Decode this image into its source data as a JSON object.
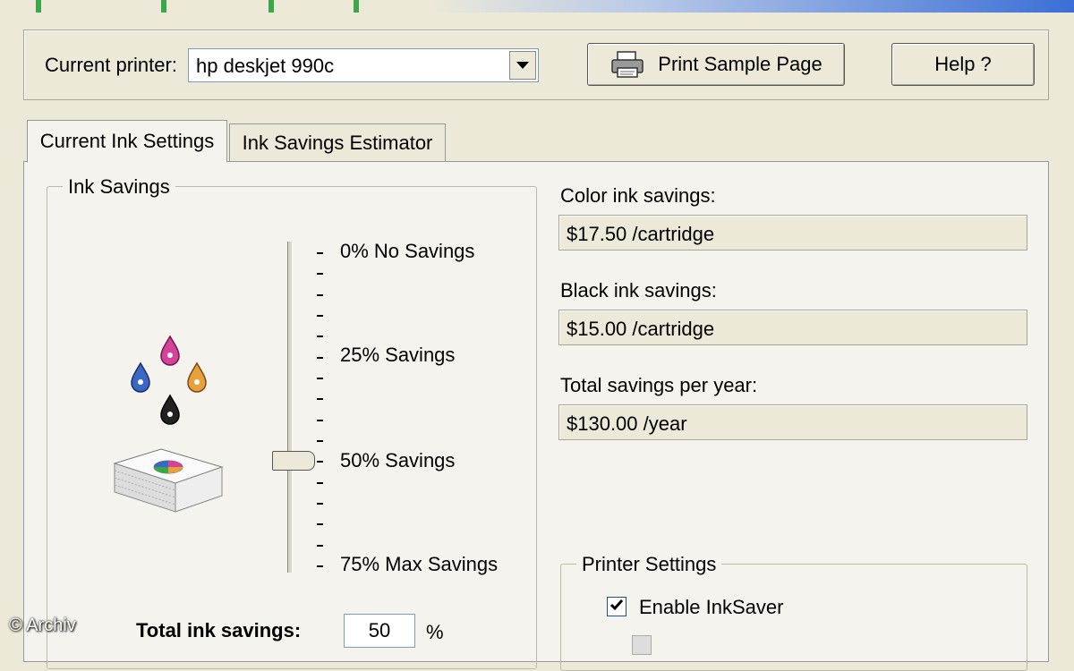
{
  "toolbar": {
    "current_printer_label": "Current printer:",
    "printer_value": "hp deskjet 990c",
    "print_sample_label": "Print Sample Page",
    "help_label": "Help ?"
  },
  "tabs": [
    {
      "label": "Current Ink Settings",
      "active": true
    },
    {
      "label": "Ink Savings Estimator",
      "active": false
    }
  ],
  "ink_savings": {
    "group_title": "Ink Savings",
    "scale": [
      {
        "percent": 0,
        "label": "0% No Savings"
      },
      {
        "percent": 25,
        "label": "25% Savings"
      },
      {
        "percent": 50,
        "label": "50% Savings"
      },
      {
        "percent": 75,
        "label": "75% Max Savings"
      }
    ],
    "slider_value_percent": 50,
    "total_label": "Total ink savings:",
    "total_value": "50",
    "total_unit": "%"
  },
  "estimates": {
    "color_label": "Color ink savings:",
    "color_value": "$17.50 /cartridge",
    "black_label": "Black ink savings:",
    "black_value": "$15.00 /cartridge",
    "total_label": "Total savings per year:",
    "total_value": "$130.00 /year"
  },
  "printer_settings": {
    "group_title": "Printer Settings",
    "enable_label": "Enable InkSaver",
    "enable_checked": true
  },
  "watermark": "© Archiv",
  "colors": {
    "background": "#ece9d8",
    "panel": "#f4f3ee",
    "drop_magenta": "#d6429a",
    "drop_blue": "#3a67c4",
    "drop_yellow": "#e8a03a",
    "drop_black": "#222222"
  }
}
